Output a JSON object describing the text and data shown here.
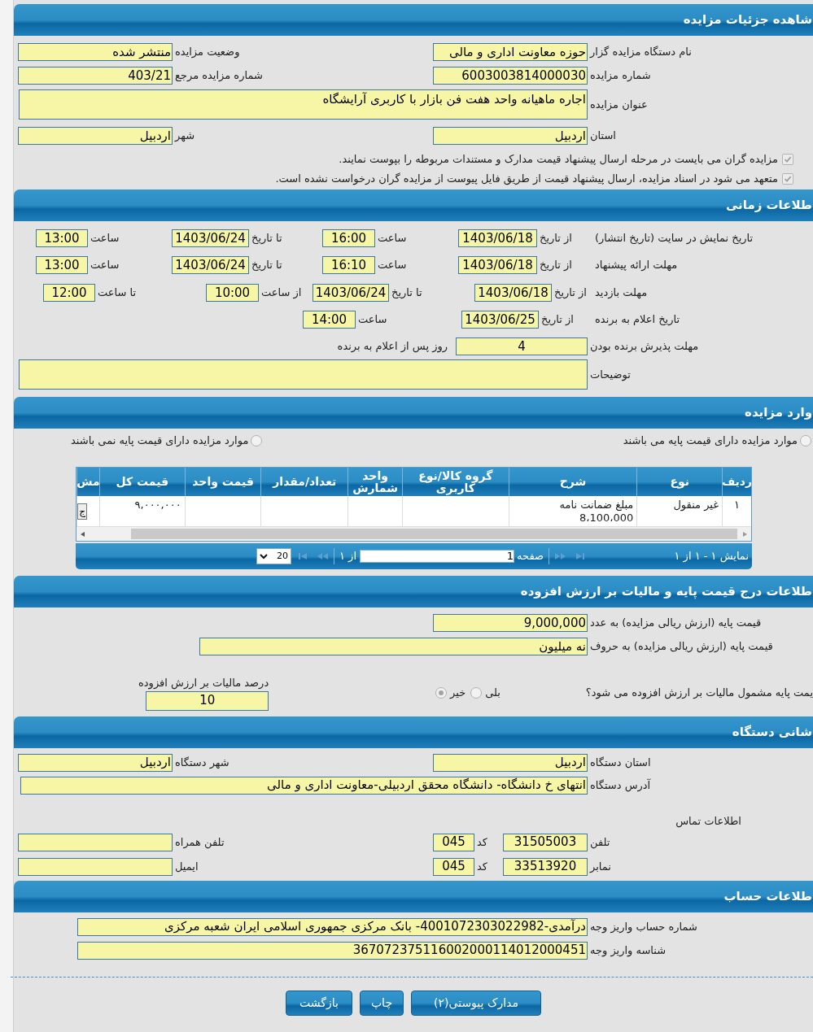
{
  "details": {
    "title": "شاهده جزئیات مزایده",
    "rows": [
      {
        "parts": [
          {
            "kind": "label",
            "text": "نام دستگاه مزایده گزار"
          },
          {
            "kind": "field",
            "value": "حوزه معاونت اداری و مالی"
          },
          {
            "kind": "label",
            "text": "وضعیت مزایده"
          },
          {
            "kind": "field",
            "value": "منتشر شده"
          }
        ]
      },
      {
        "parts": [
          {
            "kind": "label",
            "text": "شماره مزایده"
          },
          {
            "kind": "field",
            "value": "6003003814000030"
          },
          {
            "kind": "label",
            "text": "شماره مزایده مرجع"
          },
          {
            "kind": "field",
            "value": "403/21"
          }
        ]
      },
      {
        "parts": [
          {
            "kind": "label",
            "text": "عنوان مزایده"
          },
          {
            "kind": "area",
            "value": "اجاره ماهیانه واحد هفت فن بازار با کاربری آرایشگاه"
          }
        ]
      },
      {
        "parts": [
          {
            "kind": "label",
            "text": "استان"
          },
          {
            "kind": "field",
            "value": "اردبیل"
          },
          {
            "kind": "label",
            "text": "شهر"
          },
          {
            "kind": "field",
            "value": "اردبیل"
          }
        ]
      }
    ],
    "checks": [
      {
        "label": "مزایده گران می بایست در مرحله ارسال پیشنهاد قیمت مدارک و مستندات مربوطه را بپوست نمایند.",
        "checked": true
      },
      {
        "label": "متعهد می شود در اسناد مزایده، ارسال پیشنهاد قیمت از طریق فایل پیوست از مزایده گران درخواست نشده است.",
        "checked": true
      }
    ]
  },
  "timing": {
    "title": "طلاعات زمانی",
    "rows": [
      {
        "parts": [
          {
            "kind": "label",
            "text": "تاریخ نمایش در سایت (تاریخ انتشار)"
          },
          {
            "kind": "label",
            "text": "از تاریخ"
          },
          {
            "kind": "field",
            "value": "1403/06/18"
          },
          {
            "kind": "label",
            "text": "ساعت"
          },
          {
            "kind": "field",
            "value": "16:00"
          },
          {
            "kind": "label",
            "text": "تا تاریخ"
          },
          {
            "kind": "field",
            "value": "1403/06/24"
          },
          {
            "kind": "label",
            "text": "ساعت"
          },
          {
            "kind": "field",
            "value": "13:00"
          }
        ]
      },
      {
        "parts": [
          {
            "kind": "label",
            "text": "مهلت ارائه پیشنهاد"
          },
          {
            "kind": "label",
            "text": "از تاریخ"
          },
          {
            "kind": "field",
            "value": "1403/06/18"
          },
          {
            "kind": "label",
            "text": "ساعت"
          },
          {
            "kind": "field",
            "value": "16:10"
          },
          {
            "kind": "label",
            "text": "تا تاریخ"
          },
          {
            "kind": "field",
            "value": "1403/06/24"
          },
          {
            "kind": "label",
            "text": "ساعت"
          },
          {
            "kind": "field",
            "value": "13:00"
          }
        ]
      },
      {
        "parts": [
          {
            "kind": "label",
            "text": "مهلت بازدید"
          },
          {
            "kind": "label",
            "text": "از تاریخ"
          },
          {
            "kind": "field",
            "value": "1403/06/18"
          },
          {
            "kind": "label",
            "text": "تا تاریخ"
          },
          {
            "kind": "field",
            "value": "1403/06/24"
          },
          {
            "kind": "label",
            "text": "از ساعت"
          },
          {
            "kind": "field",
            "value": "10:00"
          },
          {
            "kind": "label",
            "text": "تا ساعت"
          },
          {
            "kind": "field",
            "value": "12:00"
          }
        ]
      },
      {
        "parts": [
          {
            "kind": "label",
            "text": "تاریخ اعلام به برنده"
          },
          {
            "kind": "label",
            "text": "از تاریخ"
          },
          {
            "kind": "field",
            "value": "1403/06/25"
          },
          {
            "kind": "label",
            "text": "ساعت"
          },
          {
            "kind": "field",
            "value": "14:00"
          }
        ]
      },
      {
        "parts": [
          {
            "kind": "label",
            "text": "مهلت پذیرش برنده بودن"
          },
          {
            "kind": "field",
            "value": "4"
          },
          {
            "kind": "label",
            "text": "روز پس از اعلام به برنده"
          }
        ]
      },
      {
        "parts": [
          {
            "kind": "label",
            "text": "توضیحات"
          },
          {
            "kind": "area"
          }
        ]
      }
    ]
  },
  "items": {
    "title": "وارد مزایده",
    "options": [
      {
        "label": "موارد مزایده دارای قیمت پایه می باشند",
        "selected": false
      },
      {
        "label": "موارد مزایده دارای قیمت پایه نمی باشند",
        "selected": false
      }
    ],
    "table": {
      "columns": [
        "ردیف",
        "نوع",
        "شرح",
        "گروه کالا/نوع کاربری",
        "واحد شمارش",
        "تعداد/مقدار",
        "قیمت واحد",
        "قیمت کل",
        "مش"
      ],
      "rows": [
        {
          "cells": [
            "١",
            "غیر منقول",
            "مبلغ ضمانت نامه\n8،100،000",
            "",
            "",
            "",
            "",
            "٩,٠٠٠,٠٠٠",
            "ج"
          ]
        }
      ]
    },
    "pager": {
      "summary": "نمایش ١ - ١ از ١",
      "page_label": "صفحه",
      "page": "1",
      "page_count": "از ١",
      "page_size": "20"
    }
  },
  "pricing": {
    "title": "طلاعات درج قیمت پایه و مالیات بر ارزش افزوده",
    "rows": [
      {
        "parts": [
          {
            "kind": "label",
            "text": "قیمت پایه (ارزش ریالی مزایده) به عدد"
          },
          {
            "kind": "field",
            "value": "9,000,000"
          }
        ]
      },
      {
        "parts": [
          {
            "kind": "label",
            "text": "قیمت پایه (ارزش ریالی مزایده) به حروف"
          },
          {
            "kind": "field",
            "value": "نه میلیون"
          }
        ]
      }
    ],
    "vat": {
      "question": "یمت پایه مشمول مالیات بر ارزش افزوده می شود؟",
      "options": [
        {
          "label": "بلی",
          "selected": false
        },
        {
          "label": "خیر",
          "selected": true
        }
      ],
      "percent_label": "درصد مالیات بر ارزش افزوده",
      "percent": "10"
    }
  },
  "address": {
    "title": "شانی دستگاه",
    "rows": [
      {
        "parts": [
          {
            "kind": "label",
            "text": "استان دستگاه"
          },
          {
            "kind": "field",
            "value": "اردبیل"
          },
          {
            "kind": "label",
            "text": "شهر دستگاه"
          },
          {
            "kind": "field",
            "value": "اردبیل"
          }
        ]
      },
      {
        "parts": [
          {
            "kind": "label",
            "text": "آدرس دستگاه"
          },
          {
            "kind": "field",
            "value": "انتهای خ دانشگاه- دانشگاه محقق اردبیلی-معاونت اداری و مالی"
          }
        ]
      }
    ],
    "contact_title": "اطلاعات تماس",
    "contact_rows": [
      {
        "parts": [
          {
            "kind": "label",
            "text": "تلفن"
          },
          {
            "kind": "field",
            "value": "31505003"
          },
          {
            "kind": "label",
            "text": "کد"
          },
          {
            "kind": "field",
            "value": "045"
          },
          {
            "kind": "label",
            "text": "تلفن همراه"
          },
          {
            "kind": "field"
          }
        ]
      },
      {
        "parts": [
          {
            "kind": "label",
            "text": "نمابر"
          },
          {
            "kind": "field",
            "value": "33513920"
          },
          {
            "kind": "label",
            "text": "کد"
          },
          {
            "kind": "field",
            "value": "045"
          },
          {
            "kind": "label",
            "text": "ایمیل"
          },
          {
            "kind": "field"
          }
        ]
      }
    ]
  },
  "account": {
    "title": "طلاعات حساب",
    "rows": [
      {
        "parts": [
          {
            "kind": "label",
            "text": "شماره حساب واریز وجه"
          },
          {
            "kind": "field",
            "value": "درآمدی-4001072303022982- بانک مرکزی جمهوری اسلامی ایران شعبه مرکزی"
          }
        ]
      },
      {
        "parts": [
          {
            "kind": "label",
            "text": "شناسه واریز وجه"
          },
          {
            "kind": "field",
            "value": "367072375116002000114012000451"
          }
        ]
      }
    ]
  },
  "buttons": [
    "مدارک پیوستی(٢)",
    "چاپ",
    "بازگشت"
  ]
}
